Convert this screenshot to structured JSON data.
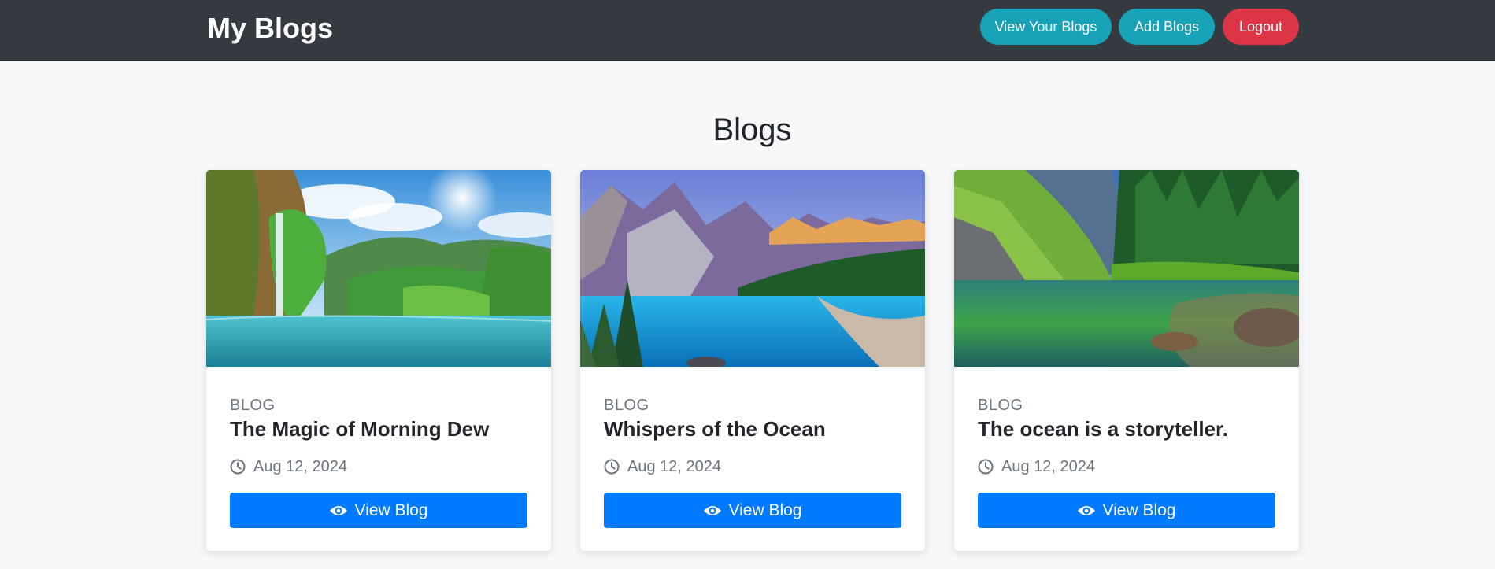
{
  "navbar": {
    "brand": "My Blogs",
    "view_your_blogs": "View Your Blogs",
    "add_blogs": "Add Blogs",
    "logout": "Logout"
  },
  "main": {
    "title": "Blogs"
  },
  "cards": [
    {
      "category": "BLOG",
      "title": "The Magic of Morning Dew",
      "date": "Aug 12, 2024",
      "button": "View Blog",
      "image": "waterfall-lake-landscape"
    },
    {
      "category": "BLOG",
      "title": "Whispers of the Ocean",
      "date": "Aug 12, 2024",
      "button": "View Blog",
      "image": "mountain-lake-landscape"
    },
    {
      "category": "BLOG",
      "title": "The ocean is a storyteller.",
      "date": "Aug 12, 2024",
      "button": "View Blog",
      "image": "forest-lake-landscape"
    }
  ],
  "icons": {
    "date": "clock-icon",
    "view": "eye-icon"
  },
  "colors": {
    "navbar_bg": "#343a40",
    "info": "#17a2b8",
    "danger": "#dc3545",
    "primary": "#007bff",
    "muted": "#6c757d"
  }
}
